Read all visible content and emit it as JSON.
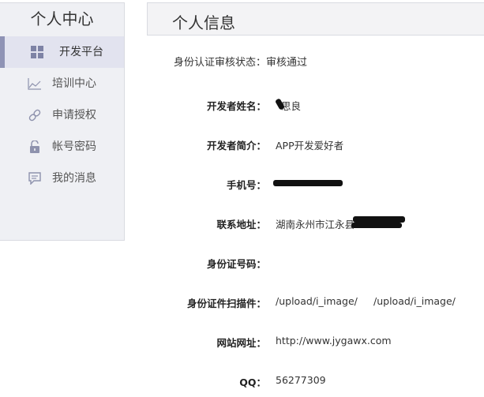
{
  "sidebar": {
    "title": "个人中心",
    "items": [
      {
        "label": "开发平台",
        "icon": "grid-icon",
        "active": true
      },
      {
        "label": "培训中心",
        "icon": "chart-icon",
        "active": false
      },
      {
        "label": "申请授权",
        "icon": "link-icon",
        "active": false
      },
      {
        "label": "帐号密码",
        "icon": "lock-icon",
        "active": false
      },
      {
        "label": "我的消息",
        "icon": "message-icon",
        "active": false
      }
    ]
  },
  "main": {
    "title": "个人信息",
    "status_label": "身份认证审核状态：",
    "status_value": "审核通过",
    "fields": [
      {
        "label": "开发者姓名：",
        "value": "思良"
      },
      {
        "label": "开发者简介：",
        "value": "APP开发爱好者"
      },
      {
        "label": "手机号：",
        "value": ""
      },
      {
        "label": "联系地址：",
        "value": "湖南永州市江永县"
      },
      {
        "label": "身份证号码：",
        "value": ""
      },
      {
        "label": "身份证件扫描件：",
        "value": "/upload/i_image/",
        "value2": "/upload/i_image/"
      },
      {
        "label": "网站网址：",
        "value": "http://www.jygawx.com"
      },
      {
        "label": "QQ：",
        "value": "56277309"
      }
    ]
  }
}
